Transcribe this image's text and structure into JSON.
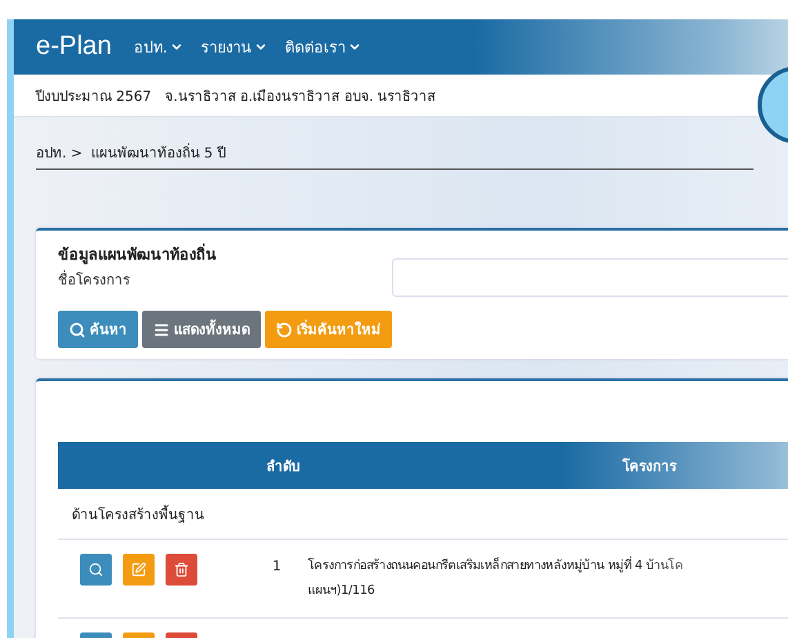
{
  "navbar": {
    "brand": "e-Plan",
    "menus": [
      {
        "label": "อปท."
      },
      {
        "label": "รายงาน"
      },
      {
        "label": "ติดต่อเรา"
      }
    ]
  },
  "info_bar": {
    "budget_year": "ปีงบประมาณ 2567",
    "location": "จ.นราธิวาส อ.เมืองนราธิวาส อบจ. นราธิวาส"
  },
  "breadcrumb": [
    "อปท. >",
    "แผนพัฒนาท้องถิ่น 5 ปี"
  ],
  "search_panel": {
    "title": "ข้อมูลแผนพัฒนาท้องถิ่น",
    "field_label": "ชื่อโครงการ",
    "buttons": [
      {
        "kind": "search",
        "label": "ค้นหา"
      },
      {
        "kind": "list",
        "label": "แสดงทั้งหมด"
      },
      {
        "kind": "reset",
        "label": "เริ่มค้นหาใหม่"
      }
    ]
  },
  "table": {
    "columns": [
      "ลำดับ",
      "โครงการ"
    ],
    "sections": [
      {
        "name": "ด้านโครงสร้างพื้นฐาน",
        "rows": [
          {
            "index": "1",
            "project": "โครงการก่อสร้างถนนคอนกรีตเสริมเหล็กสายทางหลังหมู่บ้าน หมู่ที่ 4 บ้านโค",
            "project_line2": "แผนฯ)1/116"
          },
          {}
        ]
      }
    ]
  }
}
